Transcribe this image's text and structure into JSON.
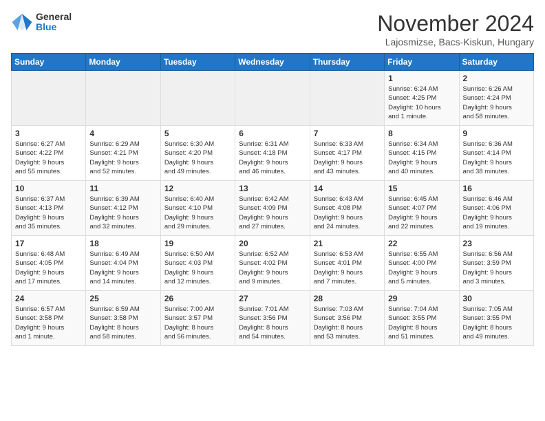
{
  "header": {
    "logo_general": "General",
    "logo_blue": "Blue",
    "month_title": "November 2024",
    "location": "Lajosmizse, Bacs-Kiskun, Hungary"
  },
  "weekdays": [
    "Sunday",
    "Monday",
    "Tuesday",
    "Wednesday",
    "Thursday",
    "Friday",
    "Saturday"
  ],
  "weeks": [
    [
      {
        "day": "",
        "info": ""
      },
      {
        "day": "",
        "info": ""
      },
      {
        "day": "",
        "info": ""
      },
      {
        "day": "",
        "info": ""
      },
      {
        "day": "",
        "info": ""
      },
      {
        "day": "1",
        "info": "Sunrise: 6:24 AM\nSunset: 4:25 PM\nDaylight: 10 hours\nand 1 minute."
      },
      {
        "day": "2",
        "info": "Sunrise: 6:26 AM\nSunset: 4:24 PM\nDaylight: 9 hours\nand 58 minutes."
      }
    ],
    [
      {
        "day": "3",
        "info": "Sunrise: 6:27 AM\nSunset: 4:22 PM\nDaylight: 9 hours\nand 55 minutes."
      },
      {
        "day": "4",
        "info": "Sunrise: 6:29 AM\nSunset: 4:21 PM\nDaylight: 9 hours\nand 52 minutes."
      },
      {
        "day": "5",
        "info": "Sunrise: 6:30 AM\nSunset: 4:20 PM\nDaylight: 9 hours\nand 49 minutes."
      },
      {
        "day": "6",
        "info": "Sunrise: 6:31 AM\nSunset: 4:18 PM\nDaylight: 9 hours\nand 46 minutes."
      },
      {
        "day": "7",
        "info": "Sunrise: 6:33 AM\nSunset: 4:17 PM\nDaylight: 9 hours\nand 43 minutes."
      },
      {
        "day": "8",
        "info": "Sunrise: 6:34 AM\nSunset: 4:15 PM\nDaylight: 9 hours\nand 40 minutes."
      },
      {
        "day": "9",
        "info": "Sunrise: 6:36 AM\nSunset: 4:14 PM\nDaylight: 9 hours\nand 38 minutes."
      }
    ],
    [
      {
        "day": "10",
        "info": "Sunrise: 6:37 AM\nSunset: 4:13 PM\nDaylight: 9 hours\nand 35 minutes."
      },
      {
        "day": "11",
        "info": "Sunrise: 6:39 AM\nSunset: 4:12 PM\nDaylight: 9 hours\nand 32 minutes."
      },
      {
        "day": "12",
        "info": "Sunrise: 6:40 AM\nSunset: 4:10 PM\nDaylight: 9 hours\nand 29 minutes."
      },
      {
        "day": "13",
        "info": "Sunrise: 6:42 AM\nSunset: 4:09 PM\nDaylight: 9 hours\nand 27 minutes."
      },
      {
        "day": "14",
        "info": "Sunrise: 6:43 AM\nSunset: 4:08 PM\nDaylight: 9 hours\nand 24 minutes."
      },
      {
        "day": "15",
        "info": "Sunrise: 6:45 AM\nSunset: 4:07 PM\nDaylight: 9 hours\nand 22 minutes."
      },
      {
        "day": "16",
        "info": "Sunrise: 6:46 AM\nSunset: 4:06 PM\nDaylight: 9 hours\nand 19 minutes."
      }
    ],
    [
      {
        "day": "17",
        "info": "Sunrise: 6:48 AM\nSunset: 4:05 PM\nDaylight: 9 hours\nand 17 minutes."
      },
      {
        "day": "18",
        "info": "Sunrise: 6:49 AM\nSunset: 4:04 PM\nDaylight: 9 hours\nand 14 minutes."
      },
      {
        "day": "19",
        "info": "Sunrise: 6:50 AM\nSunset: 4:03 PM\nDaylight: 9 hours\nand 12 minutes."
      },
      {
        "day": "20",
        "info": "Sunrise: 6:52 AM\nSunset: 4:02 PM\nDaylight: 9 hours\nand 9 minutes."
      },
      {
        "day": "21",
        "info": "Sunrise: 6:53 AM\nSunset: 4:01 PM\nDaylight: 9 hours\nand 7 minutes."
      },
      {
        "day": "22",
        "info": "Sunrise: 6:55 AM\nSunset: 4:00 PM\nDaylight: 9 hours\nand 5 minutes."
      },
      {
        "day": "23",
        "info": "Sunrise: 6:56 AM\nSunset: 3:59 PM\nDaylight: 9 hours\nand 3 minutes."
      }
    ],
    [
      {
        "day": "24",
        "info": "Sunrise: 6:57 AM\nSunset: 3:58 PM\nDaylight: 9 hours\nand 1 minute."
      },
      {
        "day": "25",
        "info": "Sunrise: 6:59 AM\nSunset: 3:58 PM\nDaylight: 8 hours\nand 58 minutes."
      },
      {
        "day": "26",
        "info": "Sunrise: 7:00 AM\nSunset: 3:57 PM\nDaylight: 8 hours\nand 56 minutes."
      },
      {
        "day": "27",
        "info": "Sunrise: 7:01 AM\nSunset: 3:56 PM\nDaylight: 8 hours\nand 54 minutes."
      },
      {
        "day": "28",
        "info": "Sunrise: 7:03 AM\nSunset: 3:56 PM\nDaylight: 8 hours\nand 53 minutes."
      },
      {
        "day": "29",
        "info": "Sunrise: 7:04 AM\nSunset: 3:55 PM\nDaylight: 8 hours\nand 51 minutes."
      },
      {
        "day": "30",
        "info": "Sunrise: 7:05 AM\nSunset: 3:55 PM\nDaylight: 8 hours\nand 49 minutes."
      }
    ]
  ]
}
